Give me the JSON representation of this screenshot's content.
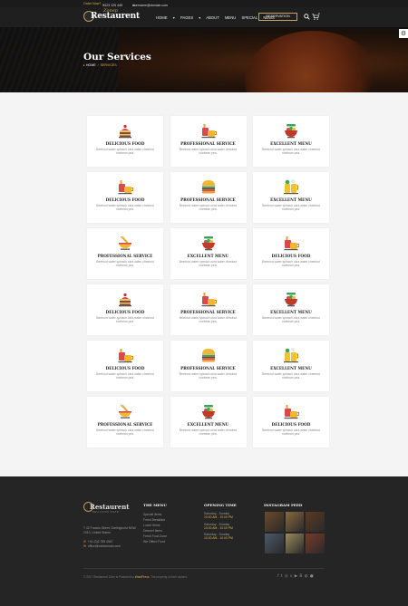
{
  "topbar": {
    "order_label": "Order Now?",
    "phone": "+123 125 445",
    "email": "username@domain.com"
  },
  "nav": {
    "logo_word": "Restaurent",
    "logo_script": "Zonep",
    "items": [
      "HOME",
      "PAGES",
      "ABOUT",
      "MENU",
      "SPECIAL",
      "NEWS"
    ],
    "reservation": "RESERVATION",
    "cart_count": "0"
  },
  "hero": {
    "title": "Our Services",
    "breadcrumb_home": "HOME",
    "breadcrumb_current": "SERVICES"
  },
  "cards": [
    {
      "icon": "cake-icon",
      "title": "DELICIOUS FOOD",
      "desc": "Beetroot water spinach okra water chestnut ricebean pea."
    },
    {
      "icon": "drinks-icon",
      "title": "PROFESSIONAL SERVICE",
      "desc": "Beetroot water spinach okra water chestnut ricebean pea."
    },
    {
      "icon": "salad-bowl-icon",
      "title": "EXCELLENT MENU",
      "desc": "Beetroot water spinach okra water chestnut ricebean pea."
    },
    {
      "icon": "drinks-icon",
      "title": "DELICIOUS FOOD",
      "desc": "Beetroot water spinach okra water chestnut ricebean pea."
    },
    {
      "icon": "burger-icon",
      "title": "PROFESSIONAL SERVICE",
      "desc": "Beetroot water spinach okra water chestnut ricebean pea."
    },
    {
      "icon": "beer-icon",
      "title": "EXCELLENT MENU",
      "desc": "Beetroot water spinach okra water chestnut ricebean pea."
    },
    {
      "icon": "noodles-icon",
      "title": "PROFESSIONAL SERVICE",
      "desc": "Beetroot water spinach okra water chestnut ricebean pea."
    },
    {
      "icon": "salad-bowl-icon",
      "title": "EXCELLENT MENU",
      "desc": "Beetroot water spinach okra water chestnut ricebean pea."
    },
    {
      "icon": "drinks-icon",
      "title": "DELICIOUS FOOD",
      "desc": "Beetroot water spinach okra water chestnut ricebean pea."
    },
    {
      "icon": "cake-icon",
      "title": "DELICIOUS FOOD",
      "desc": "Beetroot water spinach okra water chestnut ricebean pea."
    },
    {
      "icon": "drinks-icon",
      "title": "PROFESSIONAL SERVICE",
      "desc": "Beetroot water spinach okra water chestnut ricebean pea."
    },
    {
      "icon": "salad-bowl-icon",
      "title": "EXCELLENT MENU",
      "desc": "Beetroot water spinach okra water chestnut ricebean pea."
    },
    {
      "icon": "drinks-icon",
      "title": "DELICIOUS FOOD",
      "desc": "Beetroot water spinach okra water chestnut ricebean pea."
    },
    {
      "icon": "burger-icon",
      "title": "PROFESSIONAL SERVICE",
      "desc": "Beetroot water spinach okra water chestnut ricebean pea."
    },
    {
      "icon": "beer-icon",
      "title": "EXCELLENT MENU",
      "desc": "Beetroot water spinach okra water chestnut ricebean pea."
    },
    {
      "icon": "noodles-icon",
      "title": "PROFESSIONAL SERVICE",
      "desc": "Beetroot water spinach okra water chestnut ricebean pea."
    },
    {
      "icon": "salad-bowl-icon",
      "title": "EXCELLENT MENU",
      "desc": "Beetroot water spinach okra water chestnut ricebean pea."
    },
    {
      "icon": "drinks-icon",
      "title": "DELICIOUS FOOD",
      "desc": "Beetroot water spinach okra water chestnut ricebean pea."
    }
  ],
  "footer": {
    "logo_word": "Restaurent",
    "logo_sub": "DELICIOUS FOOD",
    "address": "T 42 Francis Street, Darlinghurst NSW 2010, United States",
    "phone": "+61 (0)2 789 4567",
    "email": "office@webdomain.com",
    "menu_title": "THE MENU",
    "menu_items": [
      "Special Items",
      "Fresh Breakfast",
      "Lunch Items",
      "Dessert Items",
      "Fresh Food Zone",
      "We Offerd Food"
    ],
    "hours_title": "OPENING TIME",
    "hours": [
      {
        "days": "Saturday - Sunday",
        "time": "10:00 AM - 10:00 PM"
      },
      {
        "days": "Saturday - Sunday",
        "time": "10:00 AM - 10:00 PM"
      },
      {
        "days": "Saturday - Sunday",
        "time": "10:00 AM - 10:00 PM"
      }
    ],
    "insta_title": "INSTAGRAM FEED",
    "insta_colors": [
      "#6b4a2a",
      "#8a6a3e",
      "#5c3a22",
      "#4a5a6a",
      "#9a8a5a",
      "#7a3a2a"
    ],
    "copyright": "© 2017 Restaurent Zone is Powered by",
    "copyright_brand": "WordPress",
    "copyright_tail": ". The property of their owners",
    "social_icons": [
      "facebook-icon",
      "twitter-icon",
      "instagram-icon",
      "vine-icon",
      "youtube-icon",
      "behance-icon",
      "dribbble-icon",
      "github-icon"
    ]
  }
}
